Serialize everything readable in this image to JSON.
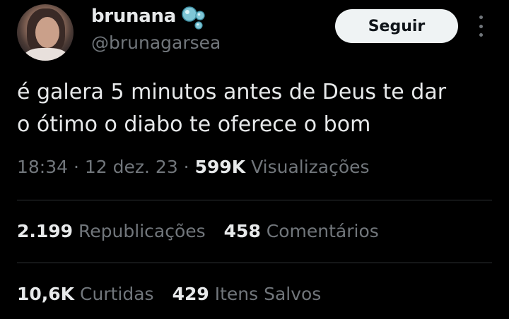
{
  "user": {
    "display_name": "brunana",
    "handle": "@brunagarsea",
    "name_emoji_icon": "bubbles-icon"
  },
  "follow_button": {
    "label": "Seguir"
  },
  "more_menu": {
    "icon": "more-vertical-icon"
  },
  "tweet": {
    "text_line1": "é galera 5 minutos antes de Deus te dar",
    "text_line2": "o ótimo o diabo te oferece o bom"
  },
  "meta": {
    "time": "18:34",
    "sep1": " · ",
    "date": "12 dez. 23",
    "sep2": " · ",
    "views_count": "599K",
    "views_label": "Visualizações"
  },
  "stats": {
    "reposts_count": "2.199",
    "reposts_label": "Republicações",
    "comments_count": "458",
    "comments_label": "Comentários",
    "likes_count": "10,6K",
    "likes_label": "Curtidas",
    "saves_count": "429",
    "saves_label": "Itens Salvos"
  },
  "colors": {
    "background": "#000000",
    "primary_text": "#e7e9ea",
    "secondary_text": "#71767b",
    "divider": "#2f3336",
    "follow_button_bg": "#eff3f4",
    "bubble_accent": "#5fb6c9"
  }
}
